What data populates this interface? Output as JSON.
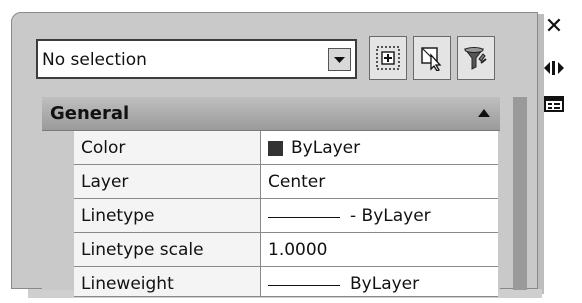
{
  "selection": {
    "value": "No selection"
  },
  "toolbar": {
    "buttons": [
      {
        "icon": "toggle-pickadd-icon"
      },
      {
        "icon": "select-objects-icon"
      },
      {
        "icon": "quick-select-icon"
      }
    ]
  },
  "strip": {
    "close_glyph": "✕",
    "autohide_icon": "autohide-icon",
    "properties_icon": "properties-menu-icon"
  },
  "section": {
    "title": "General",
    "collapsed": false
  },
  "properties": [
    {
      "name": "Color",
      "value": "ByLayer",
      "swatch": "#333333"
    },
    {
      "name": "Layer",
      "value": "Center"
    },
    {
      "name": "Linetype",
      "value": "- ByLayer",
      "line_sample": true
    },
    {
      "name": "Linetype scale",
      "value": "1.0000"
    },
    {
      "name": "Lineweight",
      "value": "ByLayer",
      "line_sample": true
    }
  ],
  "colors": {
    "panel_bg": "#c9c9c9",
    "header_gradient_top": "#bfbfbf",
    "header_gradient_bottom": "#9a9a9a",
    "swatch": "#333333"
  }
}
